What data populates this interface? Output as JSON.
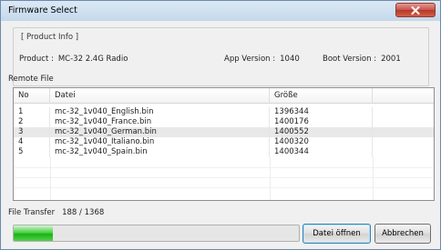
{
  "window": {
    "title": "Firmware Select"
  },
  "product_info": {
    "group_title": "[ Product Info ]",
    "product_label": "Product :",
    "product_value": "MC-32 2.4G Radio",
    "app_version_label": "App Version :",
    "app_version_value": "1040",
    "boot_version_label": "Boot Version :",
    "boot_version_value": "2001"
  },
  "remote_file": {
    "label": "Remote File",
    "columns": [
      "No",
      "Datei",
      "Größe",
      ""
    ],
    "rows": [
      {
        "no": "1",
        "file": "mc-32_1v040_English.bin",
        "size": "1396344"
      },
      {
        "no": "2",
        "file": "mc-32_1v040_France.bin",
        "size": "1400176"
      },
      {
        "no": "3",
        "file": "mc-32_1v040_German.bin",
        "size": "1400552"
      },
      {
        "no": "4",
        "file": "mc-32_1v040_Italiano.bin",
        "size": "1400320"
      },
      {
        "no": "5",
        "file": "mc-32_1v040_Spain.bin",
        "size": "1400344"
      }
    ],
    "selected_row": 3
  },
  "file_transfer": {
    "label": "File Transfer",
    "current": "188",
    "separator": "/",
    "total": "1368",
    "progress_fraction": 0.137
  },
  "buttons": {
    "open_label": "Datei öffnen",
    "cancel_label": "Abbrechen"
  },
  "colors": {
    "progress": "#18b115",
    "close_button": "#c75050",
    "titlebar": "#c4d8ec"
  }
}
